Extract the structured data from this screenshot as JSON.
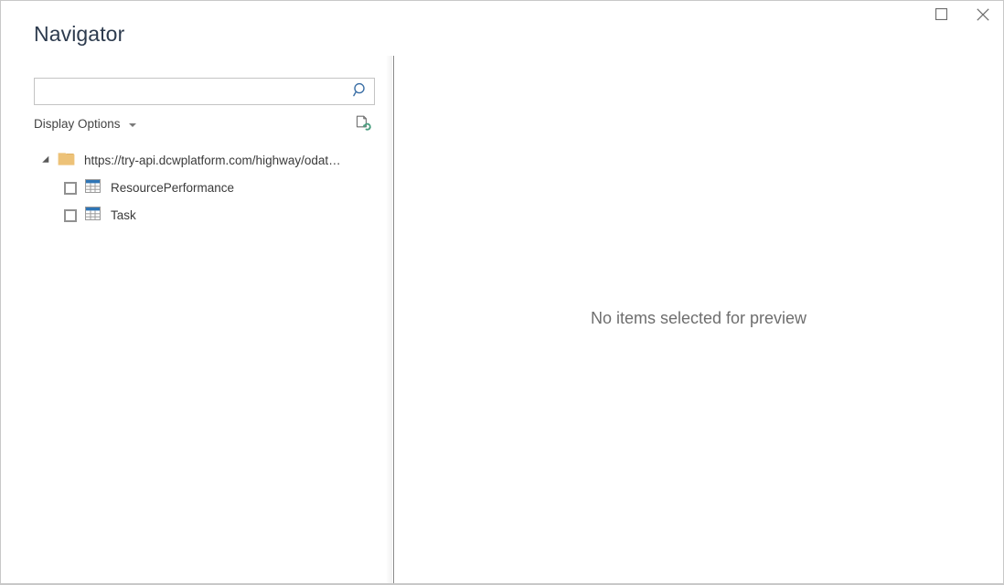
{
  "window": {
    "title": "Navigator",
    "controls": [
      {
        "name": "maximize",
        "icon": "maximize-icon",
        "label": "Maximize"
      },
      {
        "name": "close",
        "icon": "close-icon",
        "label": "Close"
      }
    ]
  },
  "search": {
    "value": "",
    "placeholder": "",
    "icon": "search-icon"
  },
  "toolbar": {
    "display_options_label": "Display Options",
    "display_options_caret": "chevron-down-icon",
    "refresh_icon": "refresh-document-icon"
  },
  "tree": {
    "root": {
      "label": "https://try-api.dcwplatform.com/highway/odat…",
      "icon": "folder-icon",
      "expanded": true,
      "expander_icon": "expander-expanded-icon"
    },
    "children": [
      {
        "label": "ResourcePerformance",
        "icon": "table-icon",
        "checked": false
      },
      {
        "label": "Task",
        "icon": "table-icon",
        "checked": false
      }
    ]
  },
  "preview": {
    "empty_message": "No items selected for preview"
  },
  "colors": {
    "title_text": "#2d3b4e",
    "body_text": "#3a3a3a",
    "preview_text": "#6e6e6e",
    "folder": "#edc278",
    "table_header": "#2e75b6",
    "search_icon": "#3a6ea5",
    "refresh_accent": "#4a9e7f",
    "border": "#c8c8c8"
  }
}
